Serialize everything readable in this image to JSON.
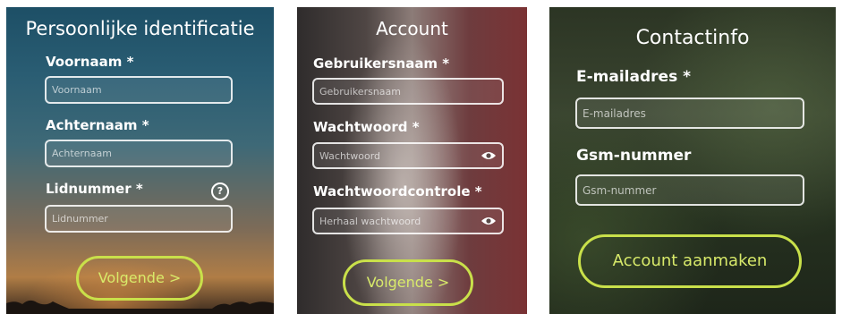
{
  "panel1": {
    "title": "Persoonlijke identificatie",
    "first_name": {
      "label": "Voornaam *",
      "placeholder": "Voornaam"
    },
    "last_name": {
      "label": "Achternaam *",
      "placeholder": "Achternaam"
    },
    "member_number": {
      "label": "Lidnummer *",
      "placeholder": "Lidnummer",
      "help_icon": "question-circle-icon",
      "help_glyph": "?"
    },
    "next_button": "Volgende >"
  },
  "panel2": {
    "title": "Account",
    "username": {
      "label": "Gebruikersnaam *",
      "placeholder": "Gebruikersnaam"
    },
    "password": {
      "label": "Wachtwoord *",
      "placeholder": "Wachtwoord",
      "icon": "eye-icon"
    },
    "password_confirm": {
      "label": "Wachtwoordcontrole *",
      "placeholder": "Herhaal wachtwoord",
      "icon": "eye-icon"
    },
    "next_button": "Volgende >"
  },
  "panel3": {
    "title": "Contactinfo",
    "email": {
      "label": "E-mailadres *",
      "placeholder": "E-mailadres"
    },
    "mobile": {
      "label": "Gsm-nummer",
      "placeholder": "Gsm-nummer"
    },
    "create_button": "Account aanmaken"
  },
  "colors": {
    "accent": "#c9e04a",
    "text": "#ffffff"
  }
}
